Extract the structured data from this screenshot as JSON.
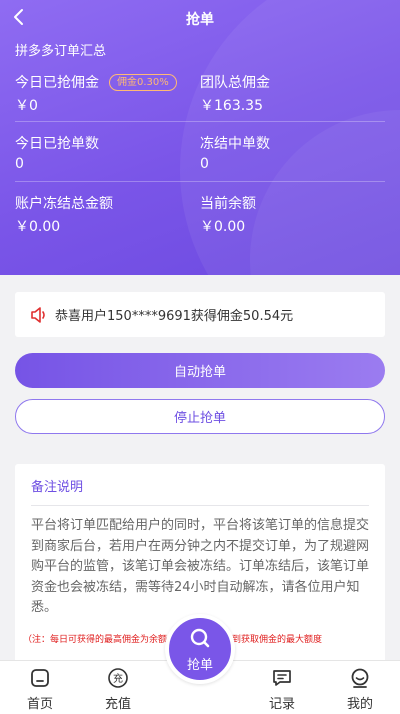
{
  "header": {
    "title": "抢单"
  },
  "summary": {
    "title": "拼多多订单汇总",
    "today_commission": {
      "label": "今日已抢佣金",
      "value": "￥0",
      "badge": "佣金0.30%"
    },
    "team_commission": {
      "label": "团队总佣金",
      "value": "￥163.35"
    },
    "today_orders": {
      "label": "今日已抢单数",
      "value": "0"
    },
    "frozen_orders": {
      "label": "冻结中单数",
      "value": "0"
    },
    "frozen_amount": {
      "label": "账户冻结总金额",
      "value": "￥0.00"
    },
    "balance": {
      "label": "当前余额",
      "value": "￥0.00"
    }
  },
  "notice": {
    "text": "恭喜用户150****9691获得佣金50.54元"
  },
  "actions": {
    "auto_grab": "自动抢单",
    "stop_grab": "停止抢单"
  },
  "remark": {
    "title": "备注说明",
    "body": "平台将订单匹配给用户的同时，平台将该笔订单的信息提交到商家后台，若用户在两分钟之内不提交订单，为了规避网购平台的监管，该笔订单会被冻结。订单冻结后，该笔订单资金也会被冻结，需等待24小时自动解冻，请各位用户知悉。",
    "note": "（注：每日可获得的最高佣金为余额的12%，若已达到获取佣金的最大额度"
  },
  "tabbar": {
    "items": [
      {
        "label": "首页",
        "icon": "home-icon"
      },
      {
        "label": "充值",
        "icon": "recharge-icon"
      },
      {
        "label": "抢单",
        "icon": "grab-icon"
      },
      {
        "label": "记录",
        "icon": "record-icon"
      },
      {
        "label": "我的",
        "icon": "profile-icon"
      }
    ]
  },
  "colors": {
    "accent": "#7a56e8",
    "badge": "#ffb974",
    "note": "#e02020",
    "speaker": "#e03030"
  }
}
